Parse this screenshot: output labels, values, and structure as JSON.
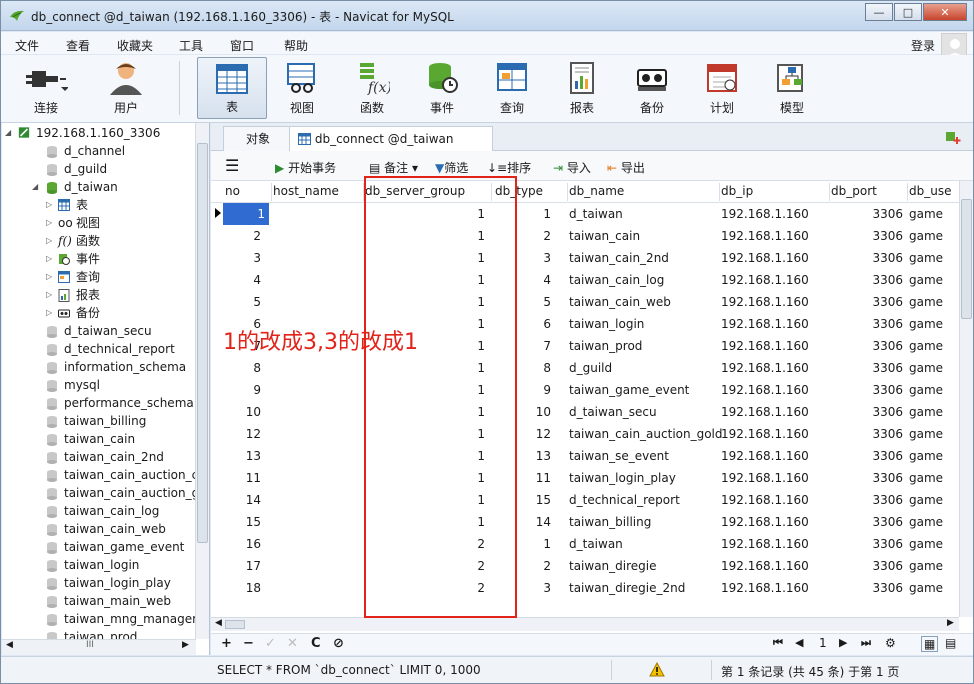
{
  "window": {
    "title": "db_connect @d_taiwan (192.168.1.160_3306) - 表 - Navicat for MySQL",
    "min": "—",
    "max": "□",
    "close": "✕"
  },
  "menu": [
    "文件",
    "查看",
    "收藏夹",
    "工具",
    "窗口",
    "帮助"
  ],
  "login": "登录",
  "toolbar": [
    {
      "label": "连接",
      "icon": "plug-icon"
    },
    {
      "label": "用户",
      "icon": "user-icon"
    },
    {
      "label": "表",
      "icon": "table-icon"
    },
    {
      "label": "视图",
      "icon": "view-icon"
    },
    {
      "label": "函数",
      "icon": "function-icon"
    },
    {
      "label": "事件",
      "icon": "event-icon"
    },
    {
      "label": "查询",
      "icon": "query-icon"
    },
    {
      "label": "报表",
      "icon": "report-icon"
    },
    {
      "label": "备份",
      "icon": "backup-icon"
    },
    {
      "label": "计划",
      "icon": "schedule-icon"
    },
    {
      "label": "模型",
      "icon": "model-icon"
    }
  ],
  "tree": {
    "connection": "192.168.1.160_3306",
    "items": [
      "d_channel",
      "d_guild",
      "d_taiwan"
    ],
    "children": [
      "表",
      "视图",
      "函数",
      "事件",
      "查询",
      "报表",
      "备份"
    ],
    "databases": [
      "d_taiwan_secu",
      "d_technical_report",
      "information_schema",
      "mysql",
      "performance_schema",
      "taiwan_billing",
      "taiwan_cain",
      "taiwan_cain_2nd",
      "taiwan_cain_auction_ce",
      "taiwan_cain_auction_gc",
      "taiwan_cain_log",
      "taiwan_cain_web",
      "taiwan_game_event",
      "taiwan_login",
      "taiwan_login_play",
      "taiwan_main_web",
      "taiwan_mng_manager",
      "taiwan_prod"
    ],
    "hscroll_label": "III"
  },
  "tabs": {
    "objects": "对象",
    "table": "db_connect @d_taiwan (192..."
  },
  "tools": {
    "begin": "开始事务",
    "note": "备注",
    "filter": "筛选",
    "sort": "排序",
    "import": "导入",
    "export": "导出"
  },
  "columns": [
    "no",
    "host_name",
    "db_server_group",
    "db_type",
    "db_name",
    "db_ip",
    "db_port",
    "db_use"
  ],
  "rows": [
    [
      "1",
      "",
      "1",
      "1",
      "d_taiwan",
      "192.168.1.160",
      "3306",
      "game"
    ],
    [
      "2",
      "",
      "1",
      "2",
      "taiwan_cain",
      "192.168.1.160",
      "3306",
      "game"
    ],
    [
      "3",
      "",
      "1",
      "3",
      "taiwan_cain_2nd",
      "192.168.1.160",
      "3306",
      "game"
    ],
    [
      "4",
      "",
      "1",
      "4",
      "taiwan_cain_log",
      "192.168.1.160",
      "3306",
      "game"
    ],
    [
      "5",
      "",
      "1",
      "5",
      "taiwan_cain_web",
      "192.168.1.160",
      "3306",
      "game"
    ],
    [
      "6",
      "",
      "1",
      "6",
      "taiwan_login",
      "192.168.1.160",
      "3306",
      "game"
    ],
    [
      "7",
      "",
      "1",
      "7",
      "taiwan_prod",
      "192.168.1.160",
      "3306",
      "game"
    ],
    [
      "8",
      "",
      "1",
      "8",
      "d_guild",
      "192.168.1.160",
      "3306",
      "game"
    ],
    [
      "9",
      "",
      "1",
      "9",
      "taiwan_game_event",
      "192.168.1.160",
      "3306",
      "game"
    ],
    [
      "10",
      "",
      "1",
      "10",
      "d_taiwan_secu",
      "192.168.1.160",
      "3306",
      "game"
    ],
    [
      "12",
      "",
      "1",
      "12",
      "taiwan_cain_auction_gold",
      "192.168.1.160",
      "3306",
      "game"
    ],
    [
      "13",
      "",
      "1",
      "13",
      "taiwan_se_event",
      "192.168.1.160",
      "3306",
      "game"
    ],
    [
      "11",
      "",
      "1",
      "11",
      "taiwan_login_play",
      "192.168.1.160",
      "3306",
      "game"
    ],
    [
      "14",
      "",
      "1",
      "15",
      "d_technical_report",
      "192.168.1.160",
      "3306",
      "game"
    ],
    [
      "15",
      "",
      "1",
      "14",
      "taiwan_billing",
      "192.168.1.160",
      "3306",
      "game"
    ],
    [
      "16",
      "",
      "2",
      "1",
      "d_taiwan",
      "192.168.1.160",
      "3306",
      "game"
    ],
    [
      "17",
      "",
      "2",
      "2",
      "taiwan_diregie",
      "192.168.1.160",
      "3306",
      "game"
    ],
    [
      "18",
      "",
      "2",
      "3",
      "taiwan_diregie_2nd",
      "192.168.1.160",
      "3306",
      "game"
    ]
  ],
  "annotation": "1的改成3,3的改成1",
  "bottom": {
    "add": "+",
    "del": "−",
    "apply": "✓",
    "cancel": "✕",
    "refresh": "C",
    "stop": "⊘",
    "page": "1"
  },
  "status": {
    "sql": "SELECT * FROM `db_connect` LIMIT 0, 1000",
    "records": "第 1 条记录 (共 45 条) 于第 1 页"
  },
  "colors": {
    "accent": "#e2231a",
    "selection": "#2f6bd0"
  }
}
